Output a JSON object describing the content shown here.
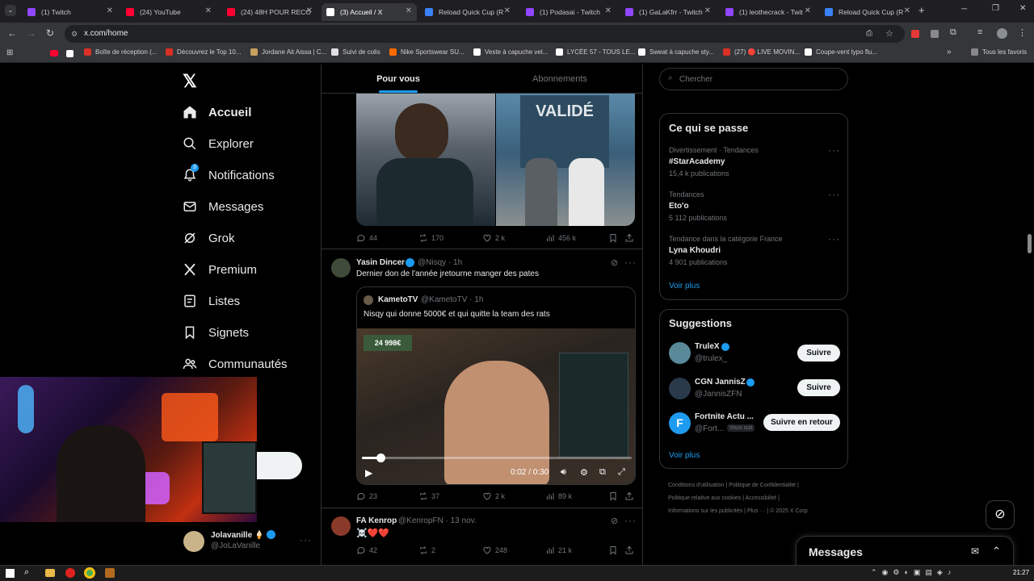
{
  "browser": {
    "tabs": [
      {
        "title": "(1) Twitch",
        "color": "#9146ff"
      },
      {
        "title": "(24) YouTube",
        "color": "#ff0033"
      },
      {
        "title": "(24) 48H POUR RECO",
        "color": "#ff0033"
      },
      {
        "title": "(3) Accueil / X",
        "color": "#ffffff"
      },
      {
        "title": "Reload Quick Cup (R",
        "color": "#3b82f6"
      },
      {
        "title": "(1) Podasai - Twitch",
        "color": "#9146ff"
      },
      {
        "title": "(1) GaLaKfrr - Twitch",
        "color": "#9146ff"
      },
      {
        "title": "(1) leothecrack - Twit",
        "color": "#9146ff"
      },
      {
        "title": "Reload Quick Cup (R",
        "color": "#3b82f6"
      }
    ],
    "url": "x.com/home",
    "bookmarks": [
      "Boîte de réception (...",
      "Découvrez le Top 10...",
      "Jordane Ait Aissa | C...",
      "Suivi de colis",
      "Nike Sportswear SU...",
      "Veste à capuche vel...",
      "LYCÉE 57 - TOUS LE...",
      "Sweat à capuche sty...",
      "(27) 🔴 LIVE MOVIN...",
      "Coupe-vent typo flu..."
    ],
    "all_bookmarks": "Tous les favoris"
  },
  "nav": {
    "items": [
      "Accueil",
      "Explorer",
      "Notifications",
      "Messages",
      "Grok",
      "Premium",
      "Listes",
      "Signets",
      "Communautés"
    ],
    "notif_badge": "3",
    "profile": {
      "name": "Jolavanille 🍦",
      "handle": "@JoLaVanille"
    }
  },
  "tabs": {
    "for_you": "Pour vous",
    "following": "Abonnements"
  },
  "post1": {
    "replies": "44",
    "reposts": "170",
    "likes": "2 k",
    "views": "456 k"
  },
  "post2": {
    "author": "Yasin Dincer",
    "handle": "@Nisqy",
    "time": "· 1h",
    "text": "Dernier don de l'année jretourne manger des pates",
    "quote": {
      "author": "KametoTV",
      "handle": "@KametoTV",
      "time": "· 1h",
      "text": "Nisqy qui donne 5000€ et qui quitte la team des rats"
    },
    "video_time": "0:02 / 0:30",
    "video_progress": 0.07,
    "replies": "23",
    "reposts": "37",
    "likes": "2 k",
    "views": "89 k"
  },
  "post3": {
    "author": "FA Kenrop",
    "handle": "@KenropFN",
    "time": "· 13 nov.",
    "text": "☠️❤️❤️",
    "replies": "42",
    "reposts": "2",
    "likes": "248",
    "views": "21 k"
  },
  "search": {
    "placeholder": "Chercher"
  },
  "trends": {
    "title": "Ce qui se passe",
    "items": [
      {
        "context": "Divertissement · Tendances",
        "name": "#StarAcademy",
        "count": "15,4 k publications"
      },
      {
        "context": "Tendances",
        "name": "Eto'o",
        "count": "5 112 publications"
      },
      {
        "context": "Tendance dans la catégorie France",
        "name": "Lyna Khoudri",
        "count": "4 901 publications"
      }
    ],
    "more": "Voir plus"
  },
  "suggestions": {
    "title": "Suggestions",
    "items": [
      {
        "name": "TrulеX",
        "handle": "@trulex_",
        "button": "Suivre"
      },
      {
        "name": "CGN JannisZ",
        "handle": "@JannisZFN",
        "button": "Suivre"
      },
      {
        "name": "Fortnite Actu ...",
        "handle": "@Fort...",
        "badge": "Vous suit",
        "button": "Suivre en retour"
      }
    ],
    "more": "Voir plus"
  },
  "footer": {
    "links": [
      "Conditions d'utilisation",
      "Politique de Confidentialité",
      "Politique relative aux cookies",
      "Accessibilité",
      "Informations sur les publicités",
      "Plus ···",
      "© 2025 X Corp."
    ]
  },
  "messages_drawer": "Messages",
  "taskbar": {
    "time": "21:27"
  }
}
